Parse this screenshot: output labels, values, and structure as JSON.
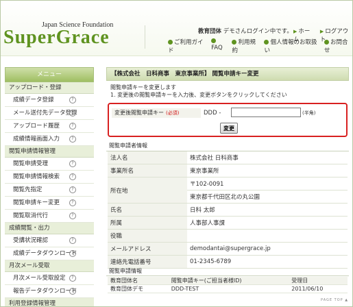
{
  "header": {
    "logo_sub": "Japan Science Foundation",
    "logo": "SuperGrace",
    "user_text_bold": "教育団体",
    "user_text": "デモさんログイン中です。",
    "home_link": "ホーム",
    "logout_link": "ログアウト",
    "guide_link": "ご利用ガイド",
    "faq_link": "FAQ",
    "terms_link": "利用規約",
    "privacy_link": "個人情報のお取扱い",
    "contact_link": "お問合せ"
  },
  "sidebar": {
    "title": "メニュー",
    "sections": [
      {
        "label": "アップロード・登録",
        "items": [
          "成績データ登録",
          "メール送付先データ登録",
          "アップロード履歴",
          "成績情報画面入力"
        ]
      },
      {
        "label": "閲覧申請情報管理",
        "items": [
          "閲覧申請受理",
          "閲覧申請情報検索",
          "閲覧先指定",
          "閲覧申請キー変更",
          "閲覧取消代行"
        ]
      },
      {
        "label": "成績閲覧・出力",
        "items": [
          "受講状況確認",
          "成績データダウンロード"
        ]
      },
      {
        "label": "月次メール受取",
        "items": [
          "月次メール受取設定",
          "報告データダウンロード"
        ]
      },
      {
        "label": "利用登録情報管理",
        "items": []
      }
    ]
  },
  "main": {
    "title": "【株式会社　日科商事　東京事業所】 閲覧申請キー変更",
    "desc1": "閲覧申請キーを変更します",
    "desc2": "1. 変更後の閲覧申請キーを入力後、変更ボタンをクリックしてください",
    "form": {
      "label": "変更後閲覧申請キー",
      "required": "(必須)",
      "prefix": "DDD -",
      "input_value": "",
      "hint": "(半角)",
      "submit": "変更"
    },
    "info_heading": "閲覧申請者情報",
    "info_rows": [
      {
        "key": "法人名",
        "value": "株式会社 日科商事"
      },
      {
        "key": "事業所名",
        "value": "東京事業所"
      },
      {
        "key": "所在地",
        "value": "〒102-0091"
      },
      {
        "key": "",
        "value": "東京都千代田区北の丸公園"
      },
      {
        "key": "氏名",
        "value": "日科 太郎"
      },
      {
        "key": "所属",
        "value": "人事部人事課"
      },
      {
        "key": "役職",
        "value": ""
      },
      {
        "key": "メールアドレス",
        "value": "demodantai@supergrace.jp"
      },
      {
        "key": "連絡先電話番号",
        "value": "01-2345-6789"
      }
    ],
    "history_heading": "閲覧申請情報",
    "history_header": [
      "教育団体名",
      "閲覧申請キー(ご担当者様ID)",
      "受理日"
    ],
    "history_rows": [
      [
        "教育団体デモ",
        "DDD-TEST",
        "2011/06/10"
      ]
    ],
    "page_top": "PAGE TOP ▲"
  },
  "colors": {
    "brand": "#5f9320",
    "required": "#d01010",
    "highlight_border": "#d82020"
  }
}
